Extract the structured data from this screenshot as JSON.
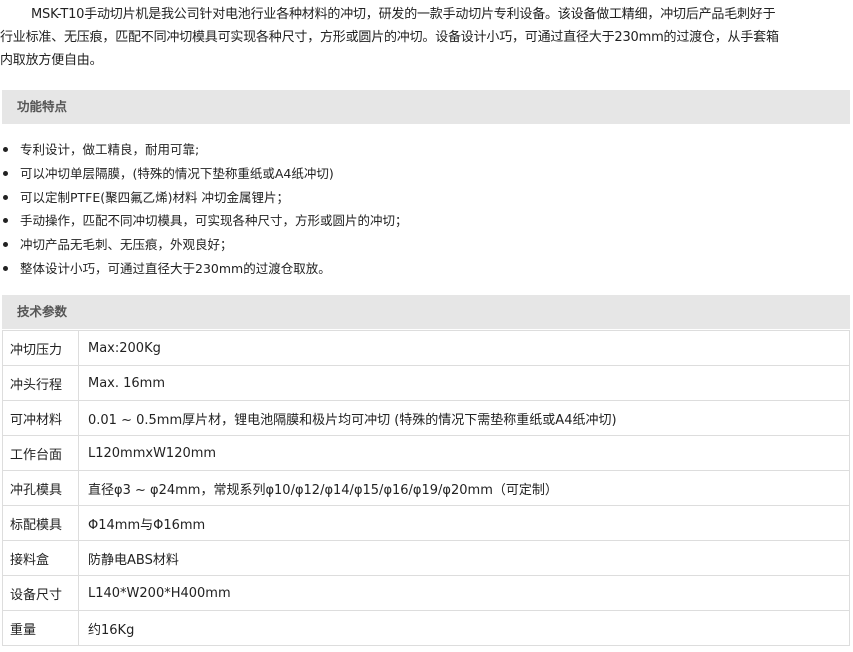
{
  "intro": {
    "lines": [
      "MSK-T10手动切片机是我公司针对电池行业各种材料的冲切，研发的一款手动切片专利设备。该设备做工精细，冲切后产品毛刺好于",
      "行业标准、无压痕，匹配不同冲切模具可实现各种尺寸，方形或圆片的冲切。设备设计小巧，可通过直径大于230mm的过渡仓，从手套箱",
      "内取放方便自由。"
    ]
  },
  "features": {
    "title": "功能特点",
    "items": [
      "专利设计，做工精良，耐用可靠;",
      "可以冲切单层隔膜，(特殊的情况下垫称重纸或A4纸冲切)",
      "可以定制PTFE(聚四氟乙烯)材料 冲切金属锂片；",
      "手动操作，匹配不同冲切模具，可实现各种尺寸，方形或圆片的冲切；",
      "冲切产品无毛刺、无压痕，外观良好；",
      "整体设计小巧，可通过直径大于230mm的过渡仓取放。"
    ]
  },
  "specs": {
    "title": "技术参数",
    "rows": [
      {
        "label": "冲切压力",
        "value": "Max:200Kg"
      },
      {
        "label": "冲头行程",
        "value": "Max. 16mm"
      },
      {
        "label": "可冲材料",
        "value": "0.01 ~ 0.5mm厚片材，锂电池隔膜和极片均可冲切 (特殊的情况下需垫称重纸或A4纸冲切)"
      },
      {
        "label": "工作台面",
        "value": "L120mmxW120mm"
      },
      {
        "label": "冲孔模具",
        "value": "直径φ3 ~ φ24mm，常规系列φ10/φ12/φ14/φ15/φ16/φ19/φ20mm（可定制）"
      },
      {
        "label": "标配模具",
        "value": "Φ14mm与Φ16mm"
      },
      {
        "label": "接料盒",
        "value": "防静电ABS材料"
      },
      {
        "label": "设备尺寸",
        "value": "L140*W200*H400mm"
      },
      {
        "label": "重量",
        "value": "约16Kg"
      }
    ]
  }
}
